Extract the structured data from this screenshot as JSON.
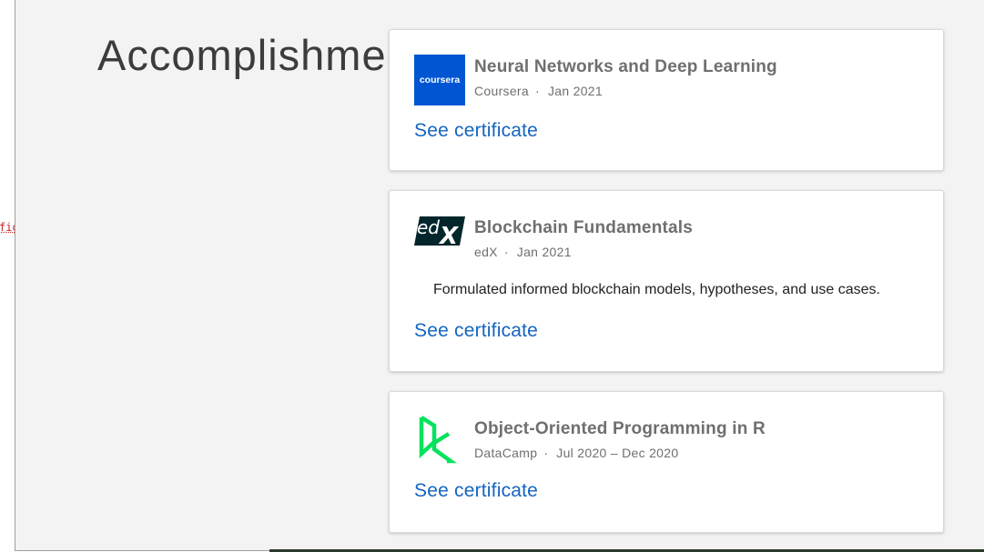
{
  "left_fragment": "fig",
  "section": {
    "title": "Accomplishments"
  },
  "colors": {
    "coursera": "#0056d2",
    "edx": "#02262b",
    "datacamp": "#05e35c",
    "link": "#1565c0"
  },
  "certificates": [
    {
      "logo": "coursera-logo",
      "logo_text": "coursera",
      "title": "Neural Networks and Deep Learning",
      "issuer": "Coursera",
      "separator": "·",
      "date": "Jan 2021",
      "description": "",
      "link_label": "See certificate"
    },
    {
      "logo": "edx-logo",
      "logo_text": "edX",
      "title": "Blockchain Fundamentals",
      "issuer": "edX",
      "separator": "·",
      "date": "Jan 2021",
      "description": "Formulated informed blockchain models, hypotheses, and use cases.",
      "link_label": "See certificate"
    },
    {
      "logo": "datacamp-logo",
      "logo_text": "",
      "title": "Object-Oriented Programming in R",
      "issuer": "DataCamp",
      "separator": "·",
      "date": "Jul 2020 – Dec 2020",
      "description": "",
      "link_label": "See certificate"
    }
  ]
}
